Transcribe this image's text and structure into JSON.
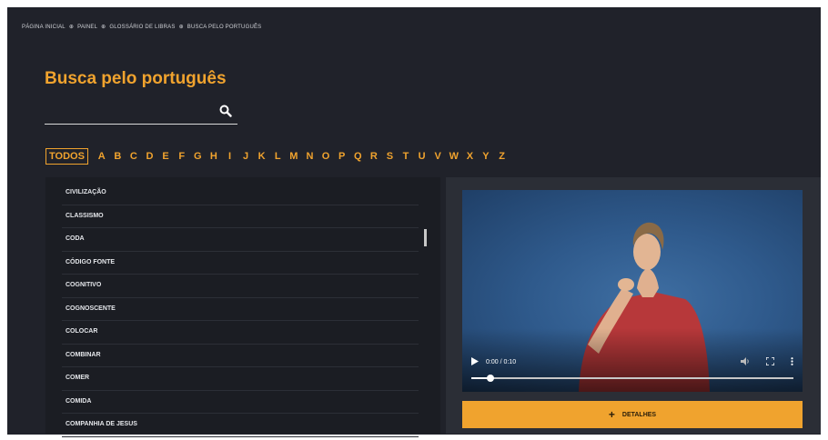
{
  "breadcrumb": {
    "items": [
      "PÁGINA INICIAL",
      "PAINEL",
      "GLOSSÁRIO DE LIBRAS",
      "BUSCA PELO PORTUGUÊS"
    ],
    "separator": "⊕"
  },
  "page": {
    "title": "Busca pelo português"
  },
  "search": {
    "value": "",
    "icon": "search-icon"
  },
  "alphabet": {
    "selected": "TODOS",
    "letters": [
      "A",
      "B",
      "C",
      "D",
      "E",
      "F",
      "G",
      "H",
      "I",
      "J",
      "K",
      "L",
      "M",
      "N",
      "O",
      "P",
      "Q",
      "R",
      "S",
      "T",
      "U",
      "V",
      "W",
      "X",
      "Y",
      "Z"
    ]
  },
  "words": {
    "items": [
      "CIVILIZAÇÃO",
      "CLASSISMO",
      "CODA",
      "CÓDIGO FONTE",
      "COGNITIVO",
      "COGNOSCENTE",
      "COLOCAR",
      "COMBINAR",
      "COMER",
      "COMIDA",
      "COMPANHIA DE JESUS"
    ]
  },
  "video": {
    "time": "0:00 / 0:10",
    "progress": 0.06,
    "play_icon": "play-icon",
    "volume_icon": "volume-icon",
    "fullscreen_icon": "fullscreen-icon",
    "menu_icon": "more-vertical-icon"
  },
  "details": {
    "label": "DETALHES",
    "icon": "plus-icon"
  },
  "colors": {
    "accent": "#f0a32e",
    "background": "#20222a",
    "panel": "#1b1d23"
  }
}
